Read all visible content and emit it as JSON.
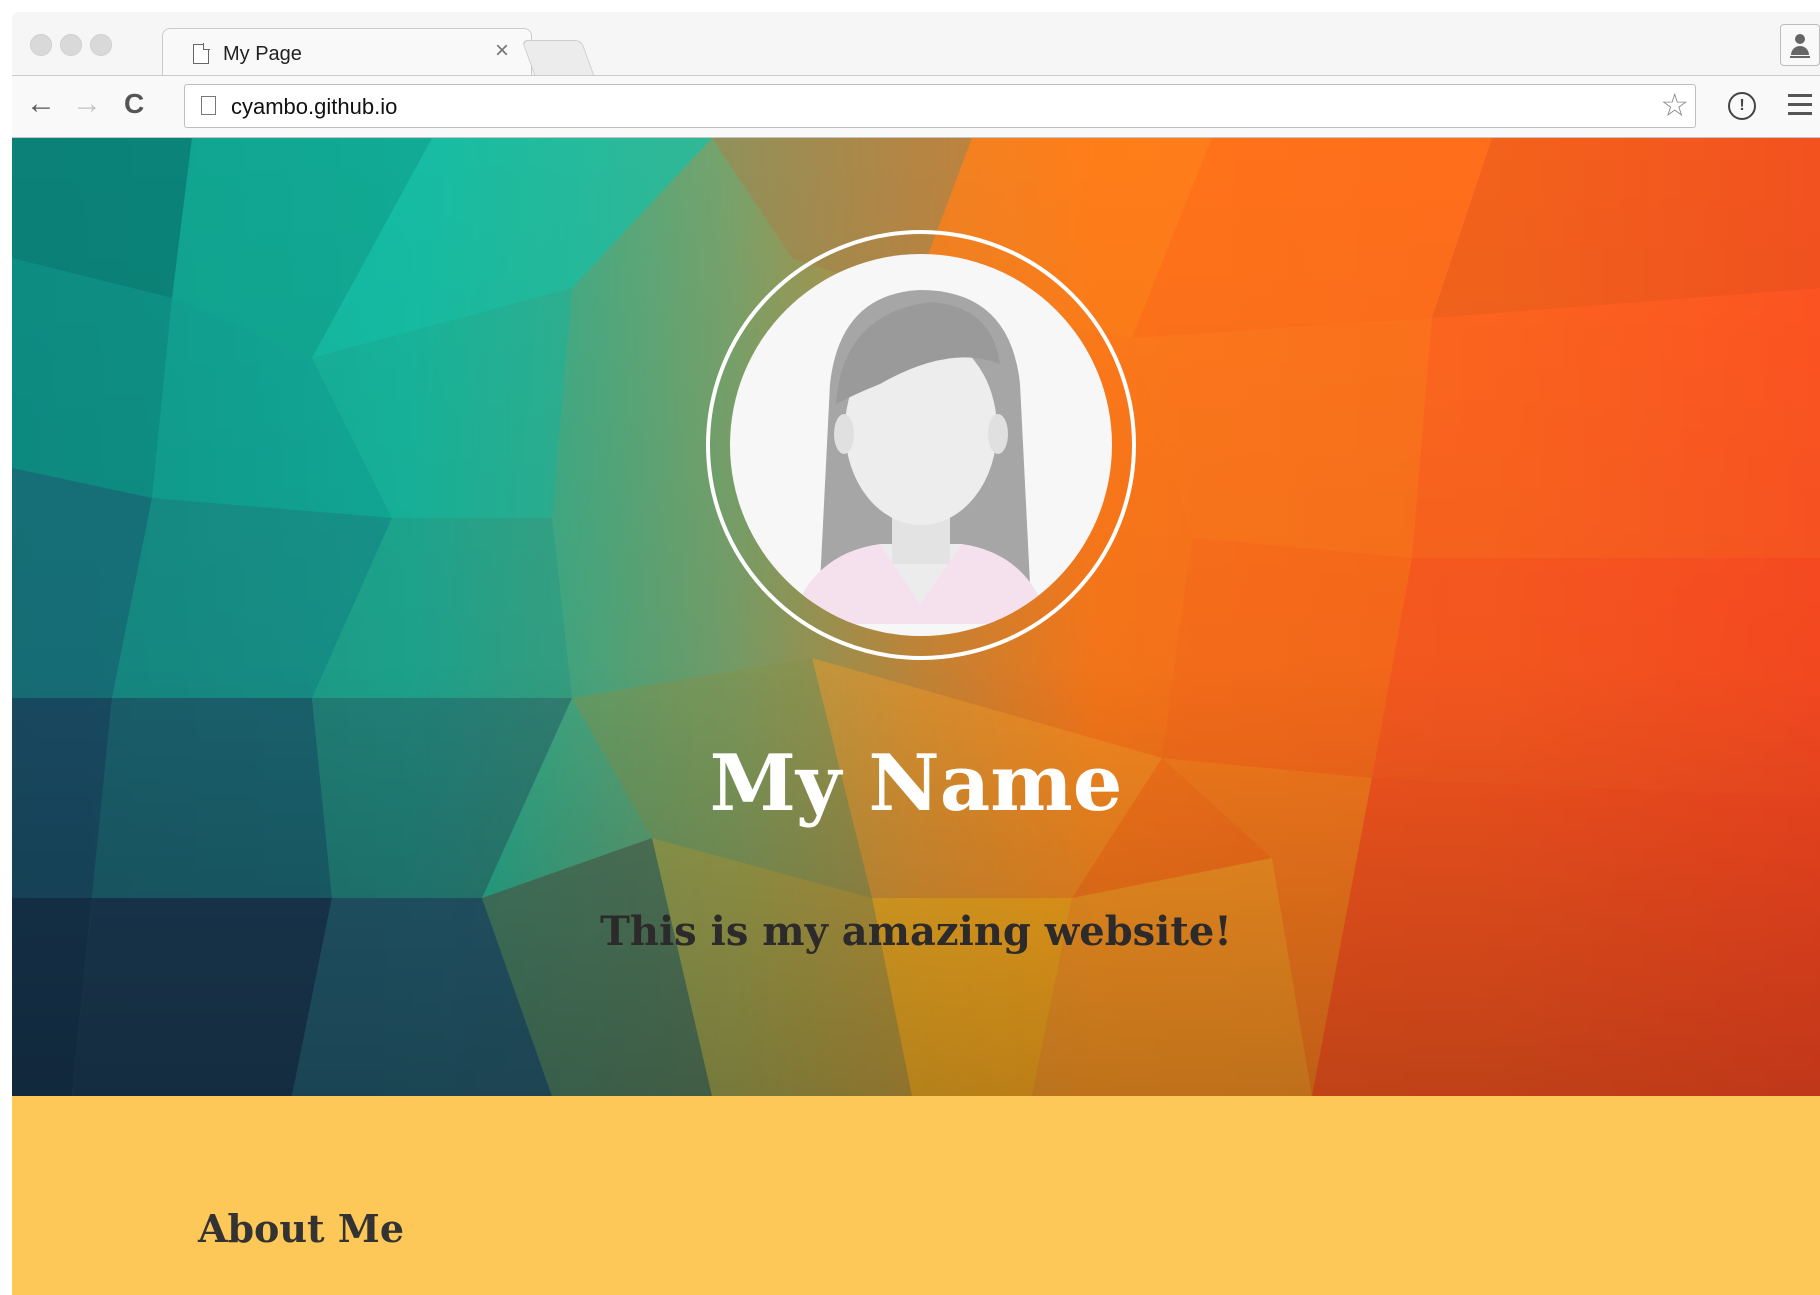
{
  "browser": {
    "tab": {
      "title": "My Page",
      "close_glyph": "×"
    },
    "toolbar": {
      "back_glyph": "←",
      "forward_glyph": "→",
      "reload_glyph": "C",
      "url": "cyambo.github.io",
      "star_glyph": "☆",
      "password_glyph": "!"
    },
    "icons": [
      "page-icon",
      "close-icon",
      "profile-icon",
      "back-icon",
      "forward-icon",
      "reload-icon",
      "star-icon",
      "password-manager-icon",
      "menu-icon"
    ]
  },
  "hero": {
    "name": "My Name",
    "tagline": "This is my amazing website!",
    "avatar_icon": "female-avatar-placeholder",
    "colors": {
      "teal": "#12b39a",
      "navy": "#1c3a52",
      "orange": "#ff7a1a",
      "red": "#ff4a22",
      "yellow": "#ffb71c"
    }
  },
  "about": {
    "title": "About Me",
    "background": "#fdc857"
  }
}
